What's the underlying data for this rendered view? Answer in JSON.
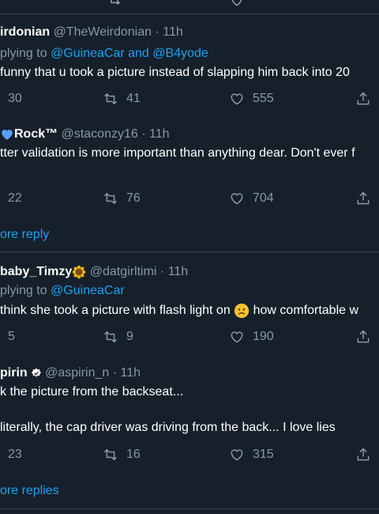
{
  "colors": {
    "background": "#15202b",
    "text": "#ffffff",
    "muted": "#8899a6",
    "link": "#1da1f2",
    "divider": "#38444d",
    "heart_emoji": "#5aa0ff",
    "sunflower": "#f5b20a",
    "sad_emoji": "#f2c230"
  },
  "icons": [
    "reply-icon",
    "retweet-icon",
    "like-icon",
    "share-icon",
    "sunflower-emoji",
    "blue-heart-emoji",
    "verified-badge-icon",
    "sad-face-emoji"
  ],
  "tweets": [
    {
      "display_name": "irdonian",
      "handle": "@TheWeirdonian",
      "sep": "·",
      "time": "11h",
      "replying_prefix": "plying to",
      "replying_to_1": "@GuineaCar",
      "replying_and": "and",
      "replying_to_2": "@B4yode",
      "text": "funny that u took a picture instead of slapping him back into 20",
      "replies": "30",
      "retweets": "41",
      "likes": "555"
    },
    {
      "display_name": "Rock™",
      "handle": "@staconzy16",
      "sep": "·",
      "time": "11h",
      "text": "tter validation is more important than anything dear. Don't ever f",
      "replies": "22",
      "retweets": "76",
      "likes": "704"
    },
    {
      "display_name": "baby_Timzy",
      "handle": "@datgirltimi",
      "sep": "·",
      "time": "11h",
      "replying_prefix": "plying to",
      "replying_to_1": "@GuineaCar",
      "text_part1": "think she took a picture with flash light on",
      "text_part2": "how comfortable w",
      "replies": "5",
      "retweets": "9",
      "likes": "190"
    },
    {
      "display_name": "pirin",
      "handle": "@aspirin_n",
      "sep": "·",
      "time": "11h",
      "text_line1": "k the picture from the backseat...",
      "text_line2": "literally, the cap driver was driving from the back... I love lies",
      "replies": "23",
      "retweets": "16",
      "likes": "315"
    }
  ],
  "show_more_1": "ore reply",
  "show_more_2": "ore replies"
}
